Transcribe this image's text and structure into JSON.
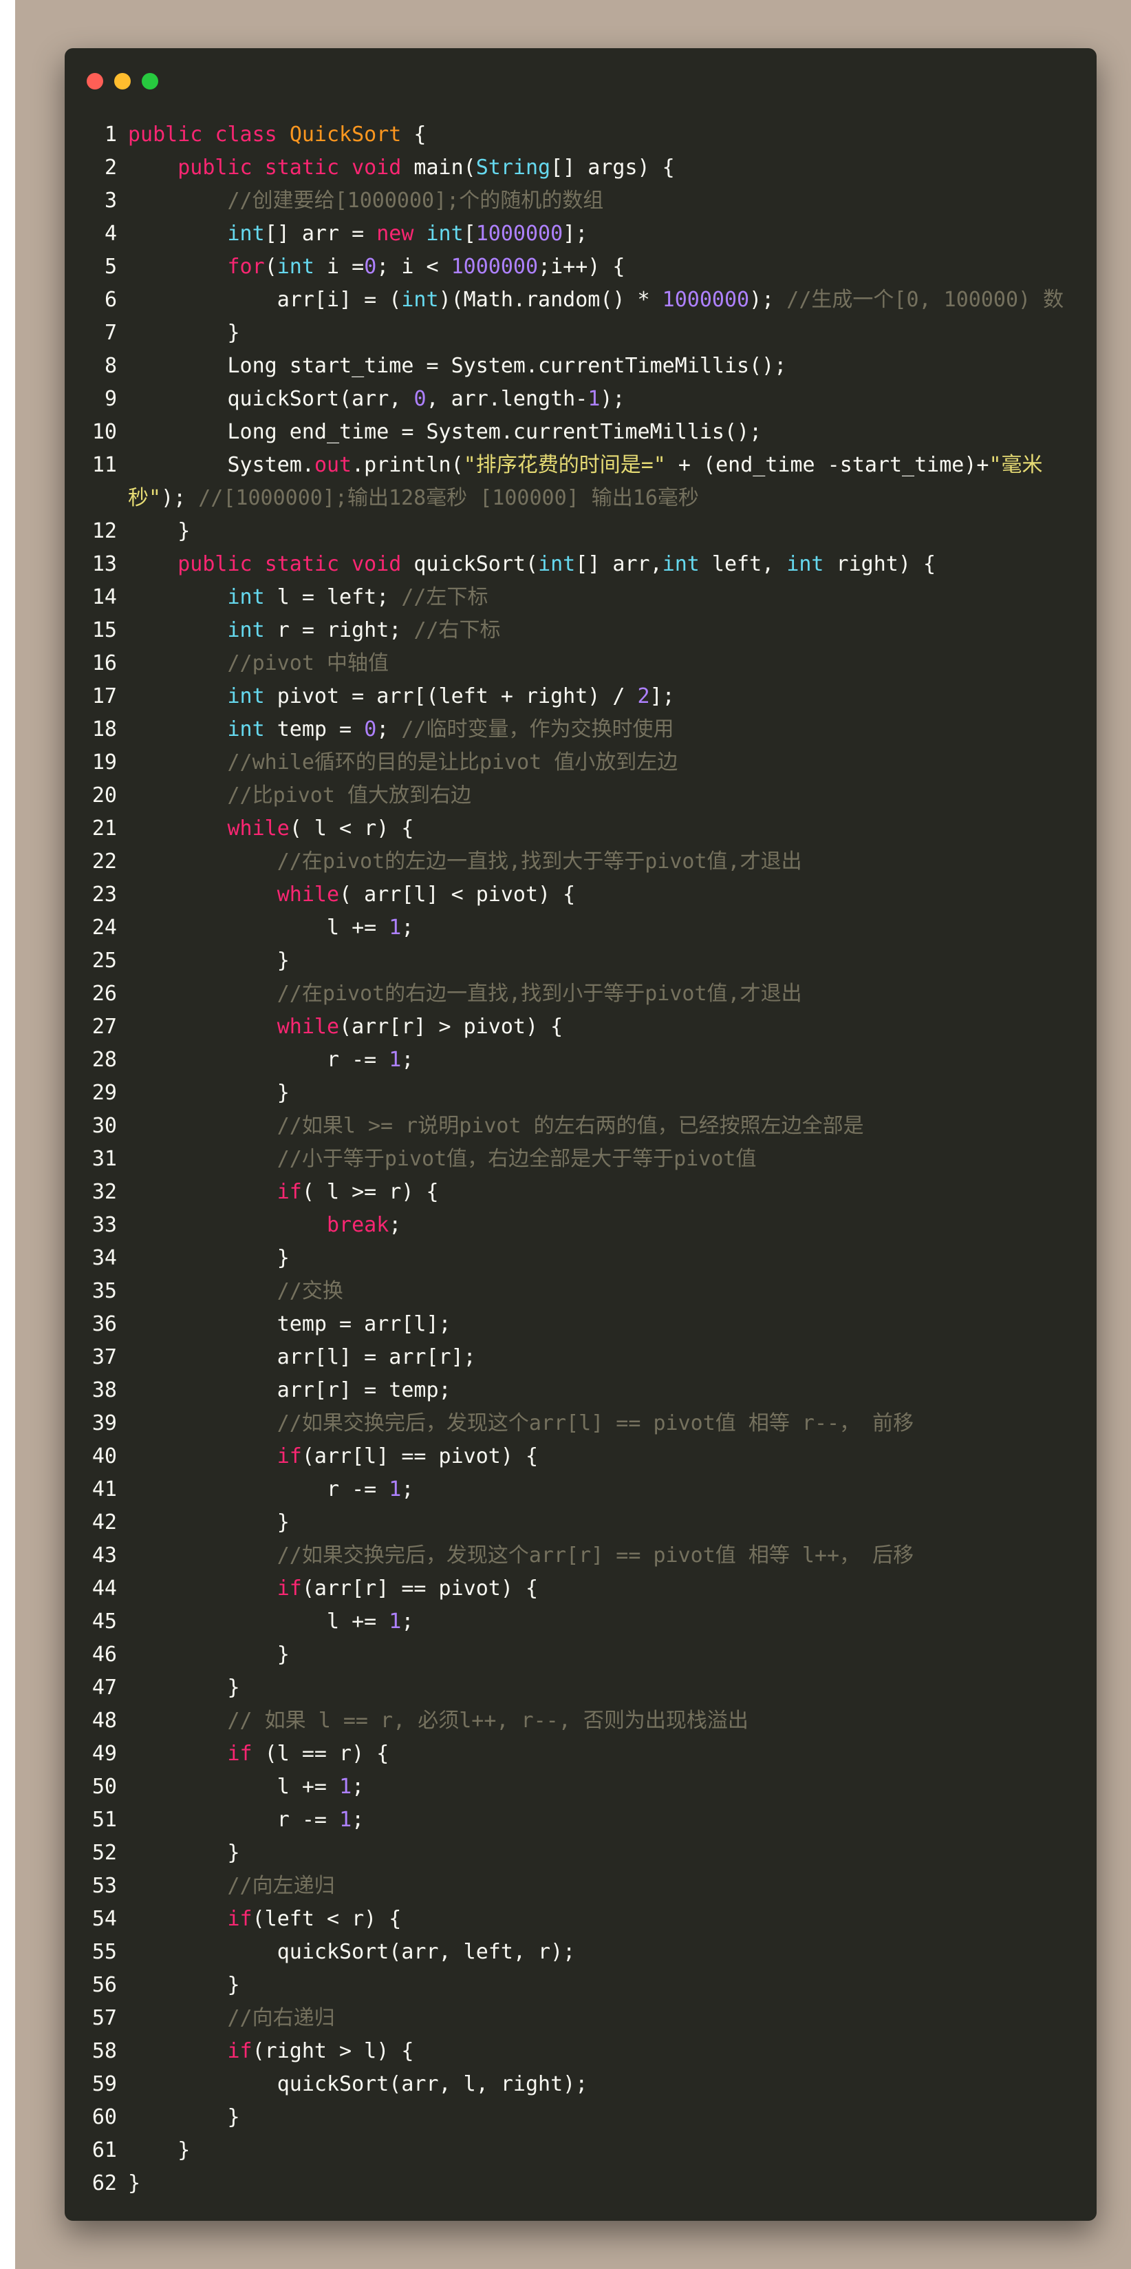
{
  "theme": {
    "backdrop": "#b9a99a",
    "window_bg": "#272822",
    "keyword": "#f92672",
    "type": "#66d9ef",
    "class_name": "#fd971f",
    "number": "#ae81ff",
    "string": "#e6db74",
    "comment": "#75715e",
    "text": "#f8f8f2"
  },
  "window_controls": [
    "red",
    "yellow",
    "green"
  ],
  "code": {
    "language": "java",
    "lines": [
      {
        "n": "1",
        "text": "public class QuickSort {"
      },
      {
        "n": "2",
        "text": "    public static void main(String[] args) {"
      },
      {
        "n": "3",
        "text": "        //创建要给[1000000];个的随机的数组"
      },
      {
        "n": "4",
        "text": "        int[] arr = new int[1000000];"
      },
      {
        "n": "5",
        "text": "        for(int i =0; i < 1000000;i++) {"
      },
      {
        "n": "6",
        "text": "            arr[i] = (int)(Math.random() * 1000000); //生成一个[0, 100000) 数"
      },
      {
        "n": "7",
        "text": "        }"
      },
      {
        "n": "8",
        "text": "        Long start_time = System.currentTimeMillis();"
      },
      {
        "n": "9",
        "text": "        quickSort(arr, 0, arr.length-1);"
      },
      {
        "n": "10",
        "text": "        Long end_time = System.currentTimeMillis();"
      },
      {
        "n": "11",
        "text": "        System.out.println(\"排序花费的时间是=\" + (end_time -start_time)+\"毫米秒\"); //[1000000];输出128毫秒 [100000] 输出16毫秒"
      },
      {
        "n": "12",
        "text": "    }"
      },
      {
        "n": "13",
        "text": "    public static void quickSort(int[] arr,int left, int right) {"
      },
      {
        "n": "14",
        "text": "        int l = left; //左下标"
      },
      {
        "n": "15",
        "text": "        int r = right; //右下标"
      },
      {
        "n": "16",
        "text": "        //pivot 中轴值"
      },
      {
        "n": "17",
        "text": "        int pivot = arr[(left + right) / 2];"
      },
      {
        "n": "18",
        "text": "        int temp = 0; //临时变量，作为交换时使用"
      },
      {
        "n": "19",
        "text": "        //while循环的目的是让比pivot 值小放到左边"
      },
      {
        "n": "20",
        "text": "        //比pivot 值大放到右边"
      },
      {
        "n": "21",
        "text": "        while( l < r) {"
      },
      {
        "n": "22",
        "text": "            //在pivot的左边一直找,找到大于等于pivot值,才退出"
      },
      {
        "n": "23",
        "text": "            while( arr[l] < pivot) {"
      },
      {
        "n": "24",
        "text": "                l += 1;"
      },
      {
        "n": "25",
        "text": "            }"
      },
      {
        "n": "26",
        "text": "            //在pivot的右边一直找,找到小于等于pivot值,才退出"
      },
      {
        "n": "27",
        "text": "            while(arr[r] > pivot) {"
      },
      {
        "n": "28",
        "text": "                r -= 1;"
      },
      {
        "n": "29",
        "text": "            }"
      },
      {
        "n": "30",
        "text": "            //如果l >= r说明pivot 的左右两的值，已经按照左边全部是"
      },
      {
        "n": "31",
        "text": "            //小于等于pivot值，右边全部是大于等于pivot值"
      },
      {
        "n": "32",
        "text": "            if( l >= r) {"
      },
      {
        "n": "33",
        "text": "                break;"
      },
      {
        "n": "34",
        "text": "            }"
      },
      {
        "n": "35",
        "text": "            //交换"
      },
      {
        "n": "36",
        "text": "            temp = arr[l];"
      },
      {
        "n": "37",
        "text": "            arr[l] = arr[r];"
      },
      {
        "n": "38",
        "text": "            arr[r] = temp;"
      },
      {
        "n": "39",
        "text": "            //如果交换完后，发现这个arr[l] == pivot值 相等 r--， 前移"
      },
      {
        "n": "40",
        "text": "            if(arr[l] == pivot) {"
      },
      {
        "n": "41",
        "text": "                r -= 1;"
      },
      {
        "n": "42",
        "text": "            }"
      },
      {
        "n": "43",
        "text": "            //如果交换完后，发现这个arr[r] == pivot值 相等 l++， 后移"
      },
      {
        "n": "44",
        "text": "            if(arr[r] == pivot) {"
      },
      {
        "n": "45",
        "text": "                l += 1;"
      },
      {
        "n": "46",
        "text": "            }"
      },
      {
        "n": "47",
        "text": "        }"
      },
      {
        "n": "48",
        "text": "        // 如果 l == r, 必须l++, r--, 否则为出现栈溢出"
      },
      {
        "n": "49",
        "text": "        if (l == r) {"
      },
      {
        "n": "50",
        "text": "            l += 1;"
      },
      {
        "n": "51",
        "text": "            r -= 1;"
      },
      {
        "n": "52",
        "text": "        }"
      },
      {
        "n": "53",
        "text": "        //向左递归"
      },
      {
        "n": "54",
        "text": "        if(left < r) {"
      },
      {
        "n": "55",
        "text": "            quickSort(arr, left, r);"
      },
      {
        "n": "56",
        "text": "        }"
      },
      {
        "n": "57",
        "text": "        //向右递归"
      },
      {
        "n": "58",
        "text": "        if(right > l) {"
      },
      {
        "n": "59",
        "text": "            quickSort(arr, l, right);"
      },
      {
        "n": "60",
        "text": "        }"
      },
      {
        "n": "61",
        "text": "    }"
      },
      {
        "n": "62",
        "text": "}"
      }
    ]
  }
}
